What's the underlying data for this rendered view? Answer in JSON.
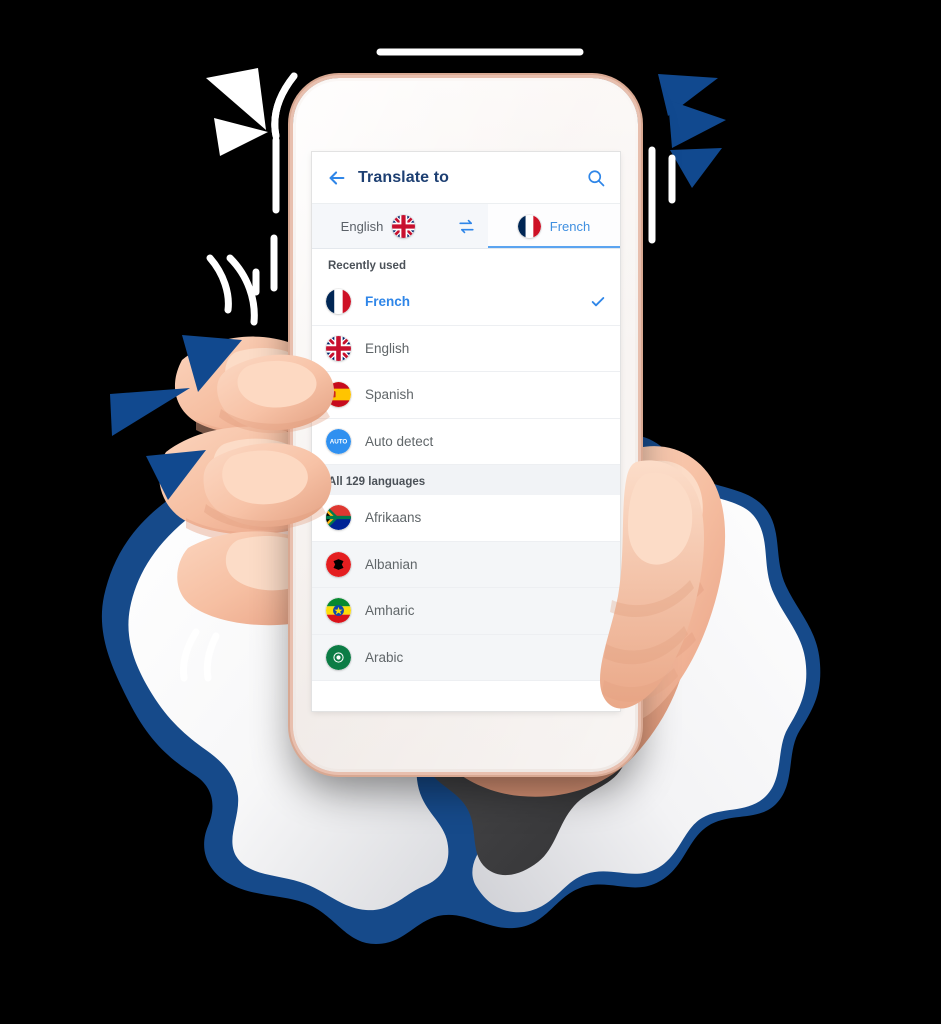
{
  "app": {
    "header": {
      "back_icon": "arrow-left-icon",
      "title": "Translate to",
      "search_icon": "search-icon"
    },
    "language_bar": {
      "source": {
        "label": "English",
        "flag": "flag-uk"
      },
      "swap_icon": "swap-horizontal-icon",
      "target": {
        "label": "French",
        "flag": "flag-france",
        "active": true
      }
    },
    "sections": [
      {
        "heading": "Recently used",
        "items": [
          {
            "label": "French",
            "flag": "flag-france",
            "selected": true,
            "check_icon": "check-icon"
          },
          {
            "label": "English",
            "flag": "flag-uk",
            "selected": false
          },
          {
            "label": "Spanish",
            "flag": "flag-spain",
            "selected": false
          },
          {
            "label": "Auto detect",
            "flag": "auto-detect-badge",
            "selected": false,
            "badge_text": "AUTO"
          }
        ]
      },
      {
        "heading": "All 129 languages",
        "items": [
          {
            "label": "Afrikaans",
            "flag": "flag-south-africa",
            "selected": false
          },
          {
            "label": "Albanian",
            "flag": "flag-albania",
            "selected": false
          },
          {
            "label": "Amharic",
            "flag": "flag-ethiopia",
            "selected": false
          },
          {
            "label": "Arabic",
            "flag": "flag-arab-league",
            "selected": false
          }
        ]
      }
    ]
  },
  "colors": {
    "accent_blue": "#2f86e8",
    "title_navy": "#1d3f72",
    "torn_paper_blue": "#164a8a",
    "burst_blue": "#11498f",
    "phone_frame": "#e8bfae",
    "screen_bg": "#f2f4f7",
    "row_text": "#606669"
  },
  "decor": {
    "burst_left_white": "white-burst-triangles",
    "burst_left_blue": "blue-burst-triangles",
    "burst_right_blue": "blue-burst-triangles",
    "torn_paper": "torn-paper-hole",
    "speed_lines": "white-speed-lines"
  }
}
